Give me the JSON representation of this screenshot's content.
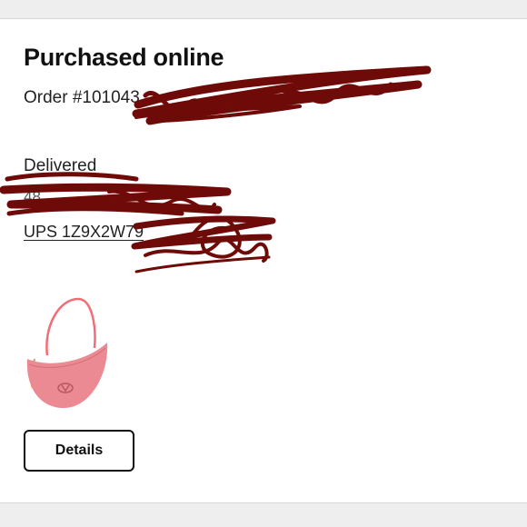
{
  "order_card": {
    "title": "Purchased online",
    "order_number": "Order #101043",
    "status": "Delivered",
    "address_partial": "48",
    "tracking": "UPS 1Z9X2W79"
  },
  "actions": {
    "details_label": "Details"
  },
  "product": {
    "icon": "pink-hobo-handbag-image",
    "bag_color": "#ec8a93",
    "strap_color": "#f06e76"
  },
  "redaction": {
    "ink_color": "#6e0b08"
  }
}
